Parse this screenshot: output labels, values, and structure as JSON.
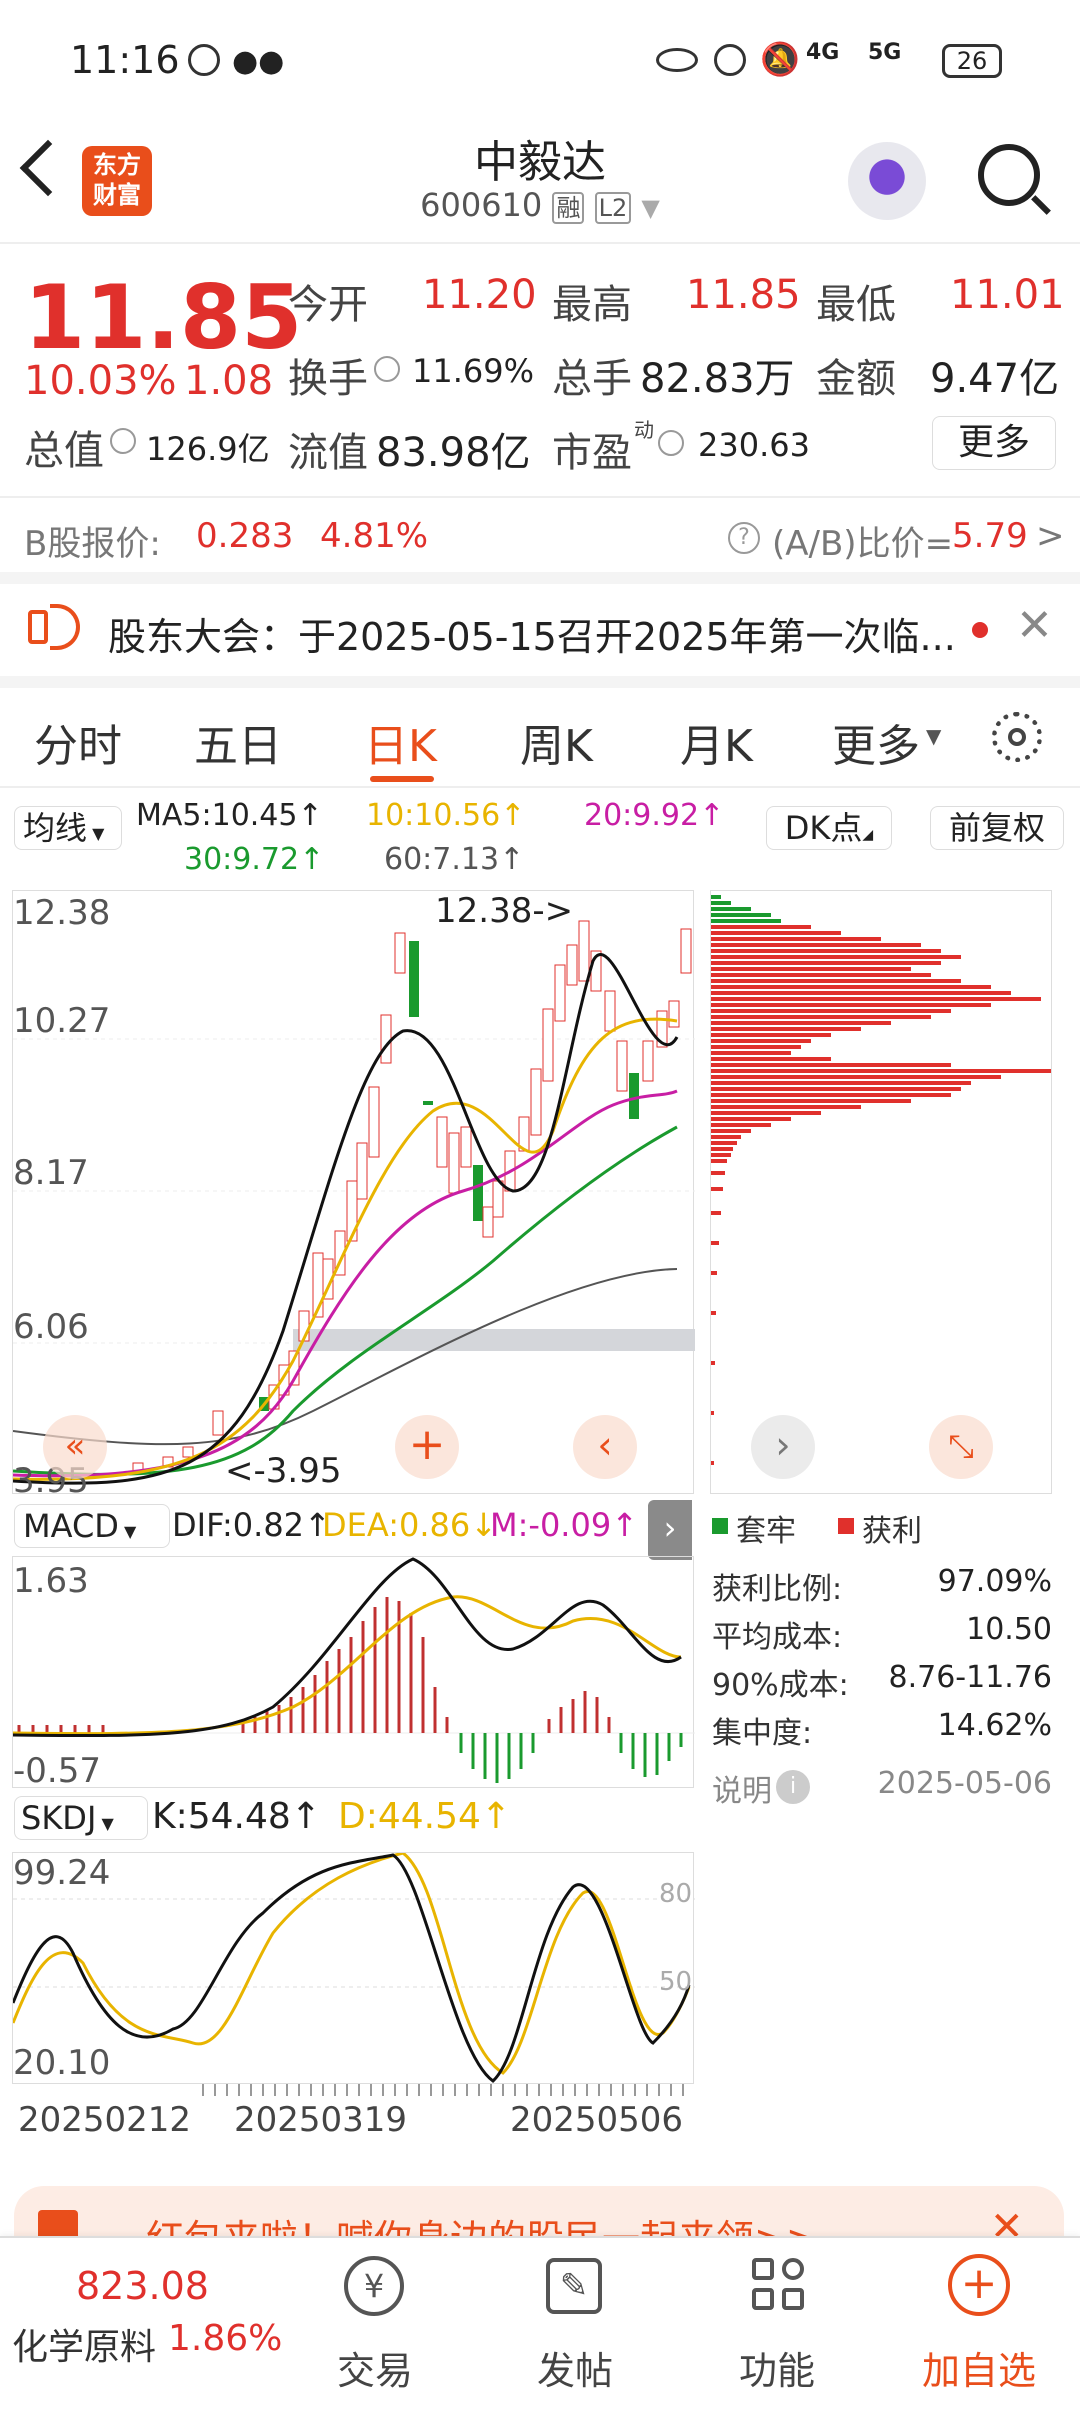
{
  "status_bar": {
    "time": "11:16",
    "net1": "4G",
    "net2": "5G",
    "battery": "26"
  },
  "header": {
    "title": "中毅达",
    "code": "600610",
    "badge_rong": "融",
    "badge_l2": "L2",
    "brand_line1": "东方",
    "brand_line2": "财富"
  },
  "quote": {
    "price": "11.85",
    "change_pct": "10.03%",
    "change": "1.08",
    "open_label": "今开",
    "open": "11.20",
    "high_label": "最高",
    "high": "11.85",
    "low_label": "最低",
    "low": "11.01",
    "turnover_label": "换手",
    "turnover": "11.69%",
    "volume_label": "总手",
    "volume": "82.83万",
    "amount_label": "金额",
    "amount": "9.47亿",
    "mcap_label": "总值",
    "mcap": "126.9亿",
    "float_label": "流值",
    "float": "83.98亿",
    "pe_label": "市盈",
    "pe_sup": "动",
    "pe": "230.63",
    "more": "更多"
  },
  "bshare": {
    "label": "B股报价:",
    "price": "0.283",
    "pct": "4.81%",
    "ratio_label": "(A/B)比价=",
    "ratio": "5.79"
  },
  "notice": {
    "text": "股东大会：于2025-05-15召开2025年第一次临..."
  },
  "tabs": [
    "分时",
    "五日",
    "日K",
    "周K",
    "月K",
    "更多"
  ],
  "active_tab": 2,
  "ma_bar": {
    "label": "均线",
    "ma5": "MA5:10.45↑",
    "ma10": "10:10.56↑",
    "ma20": "20:9.92↑",
    "ma30": "30:9.72↑",
    "ma60": "60:7.13↑",
    "dk": "DK点",
    "fq": "前复权"
  },
  "kline": {
    "y_top": "12.38",
    "y2": "10.27",
    "y3": "8.17",
    "y4": "6.06",
    "y_bottom": "3.95",
    "max_label": "12.38->",
    "min_label": "<-3.95"
  },
  "macd": {
    "label": "MACD",
    "dif": "DIF:0.82↑",
    "dea": "DEA:0.86↓",
    "m": "M:-0.09↑",
    "y_top": "1.63",
    "y_bottom": "-0.57"
  },
  "skdj": {
    "label": "SKDJ",
    "k": "K:54.48↑",
    "d": "D:44.54↑",
    "y_top": "99.24",
    "y_bottom": "20.10",
    "lvl80": "80",
    "lvl50": "50"
  },
  "dates": [
    "20250212",
    "20250319",
    "20250506"
  ],
  "chip": {
    "legend_trapped": "套牢",
    "legend_profit": "获利",
    "rows": [
      {
        "k": "获利比例:",
        "v": "97.09%"
      },
      {
        "k": "平均成本:",
        "v": "10.50"
      },
      {
        "k": "90%成本:",
        "v": "8.76-11.76"
      },
      {
        "k": "集中度:",
        "v": "14.62%"
      }
    ],
    "note_label": "说明",
    "date": "2025-05-06"
  },
  "banner": {
    "text": "红包来啦！喊你身边的股民一起来领>>"
  },
  "bottom": {
    "index_value": "823.08",
    "index_name": "化学原料",
    "index_pct": "1.86%",
    "trade": "交易",
    "post": "发帖",
    "func": "功能",
    "watch": "加自选"
  },
  "colors": {
    "up": "#e0302c",
    "down": "#1a9a2e",
    "accent": "#e94e1b",
    "dea": "#e8b400",
    "m": "#c81ea4"
  }
}
